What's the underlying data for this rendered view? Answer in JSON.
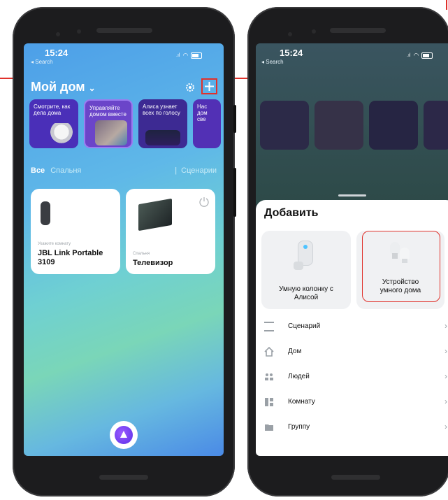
{
  "left_phone": {
    "status": {
      "time": "15:24",
      "back_label": "◂ Search"
    },
    "home": {
      "title": "Мой дом",
      "title_chevron": "⌄",
      "add_icon": "plus-icon",
      "settings_icon": "gear-icon"
    },
    "stories": [
      {
        "text": "Смотрите, как дела дома",
        "color": "#4a2fb8"
      },
      {
        "text": "Управляйте домом вместе",
        "color": "#6b45c9"
      },
      {
        "text": "Алиса узнает всех по голосу",
        "color": "#3d2a93"
      },
      {
        "text": "Нас дом све",
        "color": "#5230b5"
      }
    ],
    "filters": {
      "all": "Все",
      "bedroom": "Спальня",
      "scenarios": "Сценарии"
    },
    "devices": [
      {
        "room": "Укажите комнату",
        "name": "JBL Link Portable 3109"
      },
      {
        "room": "Спальня",
        "name": "Телевизор"
      }
    ],
    "alice_icon": "alice-icon"
  },
  "right_phone": {
    "status": {
      "time": "15:24",
      "back_label": "◂ Search"
    },
    "sheet": {
      "title": "Добавить",
      "tiles": [
        {
          "label": "Умную колонку с Алисой",
          "icon": "smart-speaker-icon"
        },
        {
          "label": "Устройство умного дома",
          "icon": "smart-bulb-icon",
          "highlighted": true
        }
      ],
      "items": [
        {
          "label": "Сценарий",
          "icon": "scenario-icon"
        },
        {
          "label": "Дом",
          "icon": "house-icon"
        },
        {
          "label": "Людей",
          "icon": "people-icon"
        },
        {
          "label": "Комнату",
          "icon": "room-icon"
        },
        {
          "label": "Группу",
          "icon": "folder-icon"
        }
      ]
    }
  },
  "colors": {
    "highlight": "#e0312b",
    "alice": "#6b3dfa",
    "accent_blue": "#4dc3ff"
  }
}
